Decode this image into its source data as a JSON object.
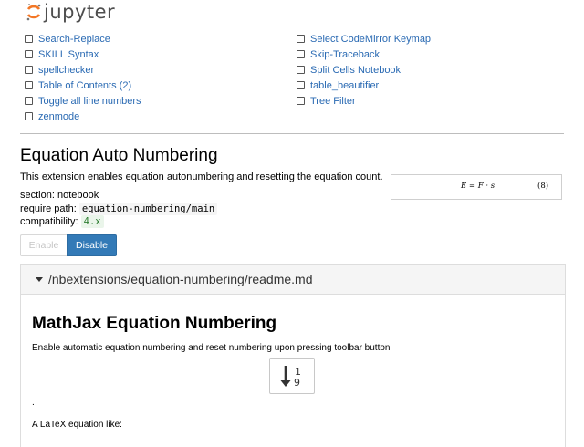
{
  "header": {
    "logo_text": "jupyter",
    "logo_accent": "#f37726"
  },
  "extensions": {
    "left": [
      {
        "label": "Search-Replace"
      },
      {
        "label": "SKILL Syntax"
      },
      {
        "label": "spellchecker"
      },
      {
        "label": "Table of Contents (2)"
      },
      {
        "label": "Toggle all line numbers"
      },
      {
        "label": "zenmode"
      }
    ],
    "right": [
      {
        "label": "Select CodeMirror Keymap"
      },
      {
        "label": "Skip-Traceback"
      },
      {
        "label": "Split Cells Notebook"
      },
      {
        "label": "table_beautifier"
      },
      {
        "label": "Tree Filter"
      }
    ]
  },
  "detail": {
    "title": "Equation Auto Numbering",
    "description": "This extension enables equation autonumbering and resetting the equation count.",
    "section_label": "section: notebook",
    "require_label": "require path:",
    "require_value": "equation-numbering/main",
    "compat_label": "compatibility:",
    "compat_value": "4.x",
    "preview_equation": "E = F · s",
    "preview_number": "(8)",
    "enable_label": "Enable",
    "disable_label": "Disable"
  },
  "readme": {
    "path": "/nbextensions/equation-numbering/readme.md",
    "title": "MathJax Equation Numbering",
    "text": "Enable automatic equation numbering and reset numbering upon pressing toolbar button",
    "icon": "sort-numeric-asc-icon",
    "dot": ".",
    "text2": "A LaTeX equation like:"
  },
  "colors": {
    "link": "#2a6ab3",
    "primary_button": "#337ab7"
  }
}
